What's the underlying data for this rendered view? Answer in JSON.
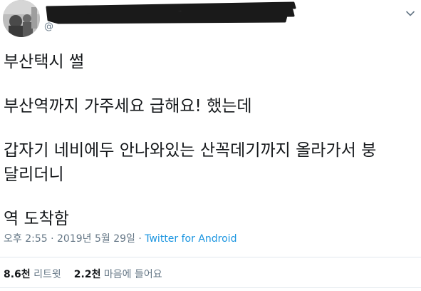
{
  "tweet": {
    "author": {
      "handle_prefix": "@",
      "avatar_icon": "profile-photo"
    },
    "menu_icon": "chevron-down-icon",
    "lines": [
      "부산택시 썰",
      "부산역까지 가주세요 급해요!  했는데",
      "갑자기 네비에두 안나와있는 산꼭데기까지 올라가서 붕",
      "달리더니",
      "역 도착함"
    ],
    "timestamp": "오후 2:55 · 2019년 5월 29일",
    "separator": " · ",
    "source": "Twitter for Android",
    "stats": {
      "retweets_count": "8.6천",
      "retweets_label": "리트윗",
      "likes_count": "2.2천",
      "likes_label": "마음에 들어요"
    }
  },
  "colors": {
    "text": "#14171a",
    "muted": "#657786",
    "link": "#1b95e0",
    "divider": "#e1e8ed"
  }
}
